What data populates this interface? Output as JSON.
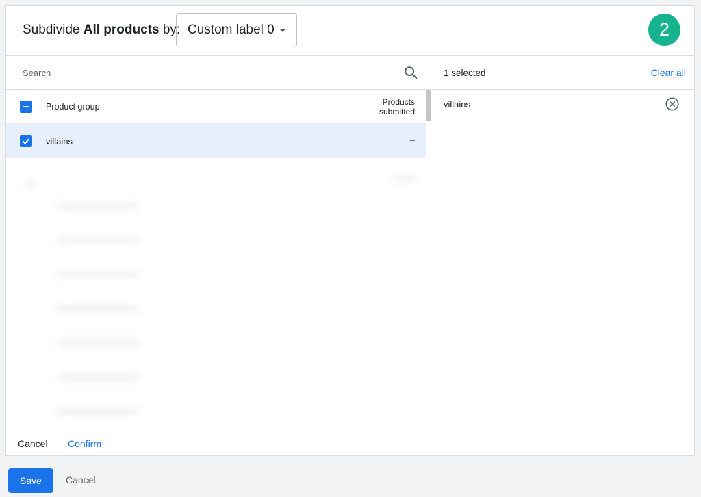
{
  "header": {
    "title_prefix": "Subdivide",
    "title_bold": "All products",
    "title_suffix": "by:",
    "dropdown_value": "Custom label 0",
    "step_number": "2",
    "step_color": "#16b38f"
  },
  "search": {
    "placeholder": "Search",
    "icon": "search-icon"
  },
  "table": {
    "col_group": "Product group",
    "col_products_line1": "Products",
    "col_products_line2": "submitted",
    "rows": [
      {
        "label": "villains",
        "products": "–",
        "checked": true
      }
    ]
  },
  "left_footer": {
    "cancel_label": "Cancel",
    "confirm_label": "Confirm"
  },
  "selection": {
    "count_label": "1 selected",
    "clear_label": "Clear all",
    "items": [
      "villains"
    ]
  },
  "actions": {
    "save_label": "Save",
    "cancel_label": "Cancel"
  },
  "colors": {
    "accent": "#1a73e8",
    "selected_row": "#e8f0fe"
  }
}
